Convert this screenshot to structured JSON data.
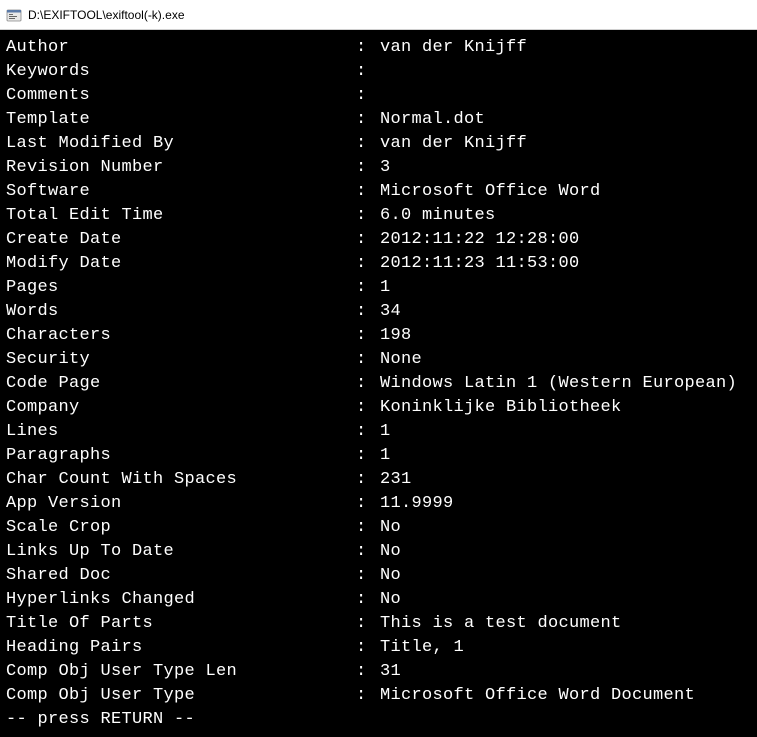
{
  "window": {
    "title": "D:\\EXIFTOOL\\exiftool(-k).exe"
  },
  "rows": [
    {
      "key": "Author",
      "value": "van der Knijff"
    },
    {
      "key": "Keywords",
      "value": ""
    },
    {
      "key": "Comments",
      "value": ""
    },
    {
      "key": "Template",
      "value": "Normal.dot"
    },
    {
      "key": "Last Modified By",
      "value": "van der Knijff"
    },
    {
      "key": "Revision Number",
      "value": "3"
    },
    {
      "key": "Software",
      "value": "Microsoft Office Word"
    },
    {
      "key": "Total Edit Time",
      "value": "6.0 minutes"
    },
    {
      "key": "Create Date",
      "value": "2012:11:22 12:28:00"
    },
    {
      "key": "Modify Date",
      "value": "2012:11:23 11:53:00"
    },
    {
      "key": "Pages",
      "value": "1"
    },
    {
      "key": "Words",
      "value": "34"
    },
    {
      "key": "Characters",
      "value": "198"
    },
    {
      "key": "Security",
      "value": "None"
    },
    {
      "key": "Code Page",
      "value": "Windows Latin 1 (Western European)"
    },
    {
      "key": "Company",
      "value": "Koninklijke Bibliotheek"
    },
    {
      "key": "Lines",
      "value": "1"
    },
    {
      "key": "Paragraphs",
      "value": "1"
    },
    {
      "key": "Char Count With Spaces",
      "value": "231"
    },
    {
      "key": "App Version",
      "value": "11.9999"
    },
    {
      "key": "Scale Crop",
      "value": "No"
    },
    {
      "key": "Links Up To Date",
      "value": "No"
    },
    {
      "key": "Shared Doc",
      "value": "No"
    },
    {
      "key": "Hyperlinks Changed",
      "value": "No"
    },
    {
      "key": "Title Of Parts",
      "value": "This is a test document"
    },
    {
      "key": "Heading Pairs",
      "value": "Title, 1"
    },
    {
      "key": "Comp Obj User Type Len",
      "value": "31"
    },
    {
      "key": "Comp Obj User Type",
      "value": "Microsoft Office Word Document"
    }
  ],
  "prompt": "-- press RETURN --",
  "colon": ":"
}
